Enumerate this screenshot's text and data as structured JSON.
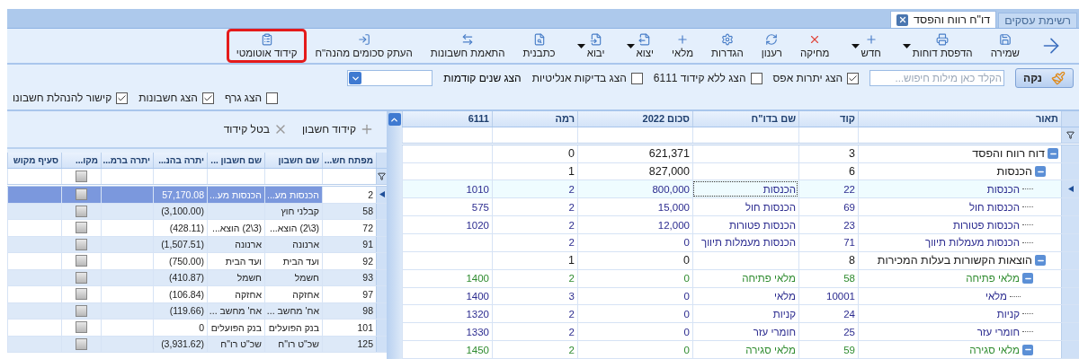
{
  "tabs": [
    {
      "label": "רשימת עסקים",
      "selected": false,
      "closable": false
    },
    {
      "label": "דו\"ח רווח והפסד",
      "selected": true,
      "closable": true
    }
  ],
  "toolbar": [
    {
      "label": "שמירה",
      "dropdown": false,
      "highlighted": false
    },
    {
      "label": "הדפסת דוחות",
      "dropdown": true,
      "highlighted": false
    },
    {
      "label": "חדש",
      "dropdown": true,
      "highlighted": false
    },
    {
      "label": "מחיקה",
      "dropdown": false,
      "highlighted": false
    },
    {
      "label": "רענון",
      "dropdown": false,
      "highlighted": false
    },
    {
      "label": "הגדרות",
      "dropdown": false,
      "highlighted": false
    },
    {
      "label": "מלאי",
      "dropdown": false,
      "highlighted": false
    },
    {
      "label": "יצוא",
      "dropdown": true,
      "highlighted": false
    },
    {
      "label": "יבוא",
      "dropdown": true,
      "highlighted": false
    },
    {
      "label": "כתבנית",
      "dropdown": false,
      "highlighted": false
    },
    {
      "label": "התאמת חשבונות",
      "dropdown": false,
      "highlighted": false
    },
    {
      "label": "העתק סכומים מהנה\"ח",
      "dropdown": false,
      "highlighted": false
    },
    {
      "label": "קידוד אוטומטי",
      "dropdown": false,
      "highlighted": true
    }
  ],
  "filters": {
    "clear_button": "נקה",
    "search": {
      "placeholder": "הקלד כאן מילות חיפוש..."
    },
    "options": [
      {
        "label": "הצג יתרות אפס",
        "checked": true
      },
      {
        "label": "הצג ללא קידוד 6111",
        "checked": false
      },
      {
        "label": "הצג בדיקות אנליטיות",
        "checked": false
      }
    ],
    "previous_years": {
      "label": "הצג שנים קודמות"
    },
    "display_options": [
      {
        "label": "הצג גרף",
        "checked": false
      },
      {
        "label": "הצג חשבונות",
        "checked": true
      },
      {
        "label": "קישור להנהלת חשבונו",
        "checked": true
      }
    ]
  },
  "report": {
    "columns": [
      "תאור",
      "קוד",
      "שם בדו\"ח",
      "סכום 2022",
      "רמה",
      "6111"
    ],
    "rows": [
      {
        "cells": [
          "דוח רווח והפסד",
          "3",
          "",
          "621,371",
          "0",
          ""
        ],
        "color": "#1a1a1a",
        "selected": false,
        "expanded": true,
        "children": [
          {
            "cells": [
              "הכנסות",
              "6",
              "",
              "827,000",
              "1",
              ""
            ],
            "color": "#1a1a1a",
            "selected": false,
            "expanded": true,
            "children": [
              {
                "cells": [
                  "הכנסות",
                  "22",
                  "הכנסות",
                  "800,000",
                  "2",
                  "1010"
                ],
                "color": "#2b2b8f",
                "selected": true
              },
              {
                "cells": [
                  "הכנסות חול",
                  "69",
                  "הכנסות חול",
                  "15,000",
                  "2",
                  "575"
                ],
                "color": "#2b2b8f",
                "selected": false
              },
              {
                "cells": [
                  "הכנסות פטורות",
                  "23",
                  "הכנסות פטורות",
                  "12,000",
                  "2",
                  "1020"
                ],
                "color": "#2b2b8f",
                "selected": false
              },
              {
                "cells": [
                  "הכנסות מעמלות תיווך",
                  "71",
                  "הכנסות מעמלות תיווך",
                  "0",
                  "2",
                  ""
                ],
                "color": "#2b2b8f",
                "selected": false
              }
            ]
          },
          {
            "cells": [
              "הוצאות  הקשורות בעלות המכירות",
              "8",
              "",
              "0",
              "1",
              ""
            ],
            "color": "#1a1a1a",
            "selected": false,
            "expanded": true,
            "children": [
              {
                "cells": [
                  "מלאי פתיחה",
                  "58",
                  "מלאי פתיחה",
                  "0",
                  "2",
                  "1400"
                ],
                "color": "#2e8b2e",
                "selected": false,
                "expanded": true,
                "children": [
                  {
                    "cells": [
                      "מלאי",
                      "10001",
                      "מלאי",
                      "0",
                      "3",
                      "1400"
                    ],
                    "color": "#2b2b8f",
                    "selected": false
                  }
                ]
              },
              {
                "cells": [
                  "קניות",
                  "24",
                  "קניות",
                  "0",
                  "2",
                  "1320"
                ],
                "color": "#2b2b8f",
                "selected": false
              },
              {
                "cells": [
                  "חומרי עזר",
                  "25",
                  "חומרי עזר",
                  "0",
                  "2",
                  "1330"
                ],
                "color": "#2b2b8f",
                "selected": false
              },
              {
                "cells": [
                  "מלאי סגירה",
                  "59",
                  "מלאי סגירה",
                  "0",
                  "2",
                  "1450"
                ],
                "color": "#2e8b2e",
                "selected": false,
                "expanded": true
              }
            ]
          }
        ]
      }
    ]
  },
  "accounts": {
    "actions": [
      "קידוד חשבון",
      "בטל קידוד"
    ],
    "filter": {
      "checked": false
    },
    "columns": [
      "מפתח חש...",
      "שם חשבון",
      "שם חשבון ...",
      "יתרה בהנ...",
      "יתרה ברמ...",
      "מקו...",
      "סעיף מקוש"
    ],
    "rows": [
      {
        "cells": [
          "2",
          "הכנסות מע...",
          "הכנסות מע...",
          "57,170.08",
          ""
        ],
        "checked": false,
        "selected": true
      },
      {
        "cells": [
          "58",
          "קבלני חוץ",
          "",
          "(3,100.00)",
          ""
        ],
        "checked": false,
        "selected": false
      },
      {
        "cells": [
          "72",
          "(3\\2) הוצא...",
          "(3\\2) הוצא...",
          "(428.11)",
          ""
        ],
        "checked": false,
        "selected": false
      },
      {
        "cells": [
          "91",
          "ארנונה",
          "ארנונה",
          "(1,507.51)",
          ""
        ],
        "checked": false,
        "selected": false
      },
      {
        "cells": [
          "92",
          "ועד הבית",
          "ועד הבית",
          "(750.00)",
          ""
        ],
        "checked": false,
        "selected": false
      },
      {
        "cells": [
          "93",
          "חשמל",
          "חשמל",
          "(410.87)",
          ""
        ],
        "checked": false,
        "selected": false
      },
      {
        "cells": [
          "97",
          "אחזקה",
          "אחזקה",
          "(106.84)",
          ""
        ],
        "checked": false,
        "selected": false
      },
      {
        "cells": [
          "98",
          "אח' מחשב ...",
          "אח' מחשב ...",
          "(119.66)",
          ""
        ],
        "checked": false,
        "selected": false
      },
      {
        "cells": [
          "101",
          "בנק הפועלים",
          "בנק הפועלים",
          "0",
          ""
        ],
        "checked": false,
        "selected": false
      },
      {
        "cells": [
          "125",
          "שכ\"ט רו\"ח",
          "שכ\"ט רו\"ח",
          "(3,931.62)",
          ""
        ],
        "checked": false,
        "selected": false
      }
    ]
  }
}
